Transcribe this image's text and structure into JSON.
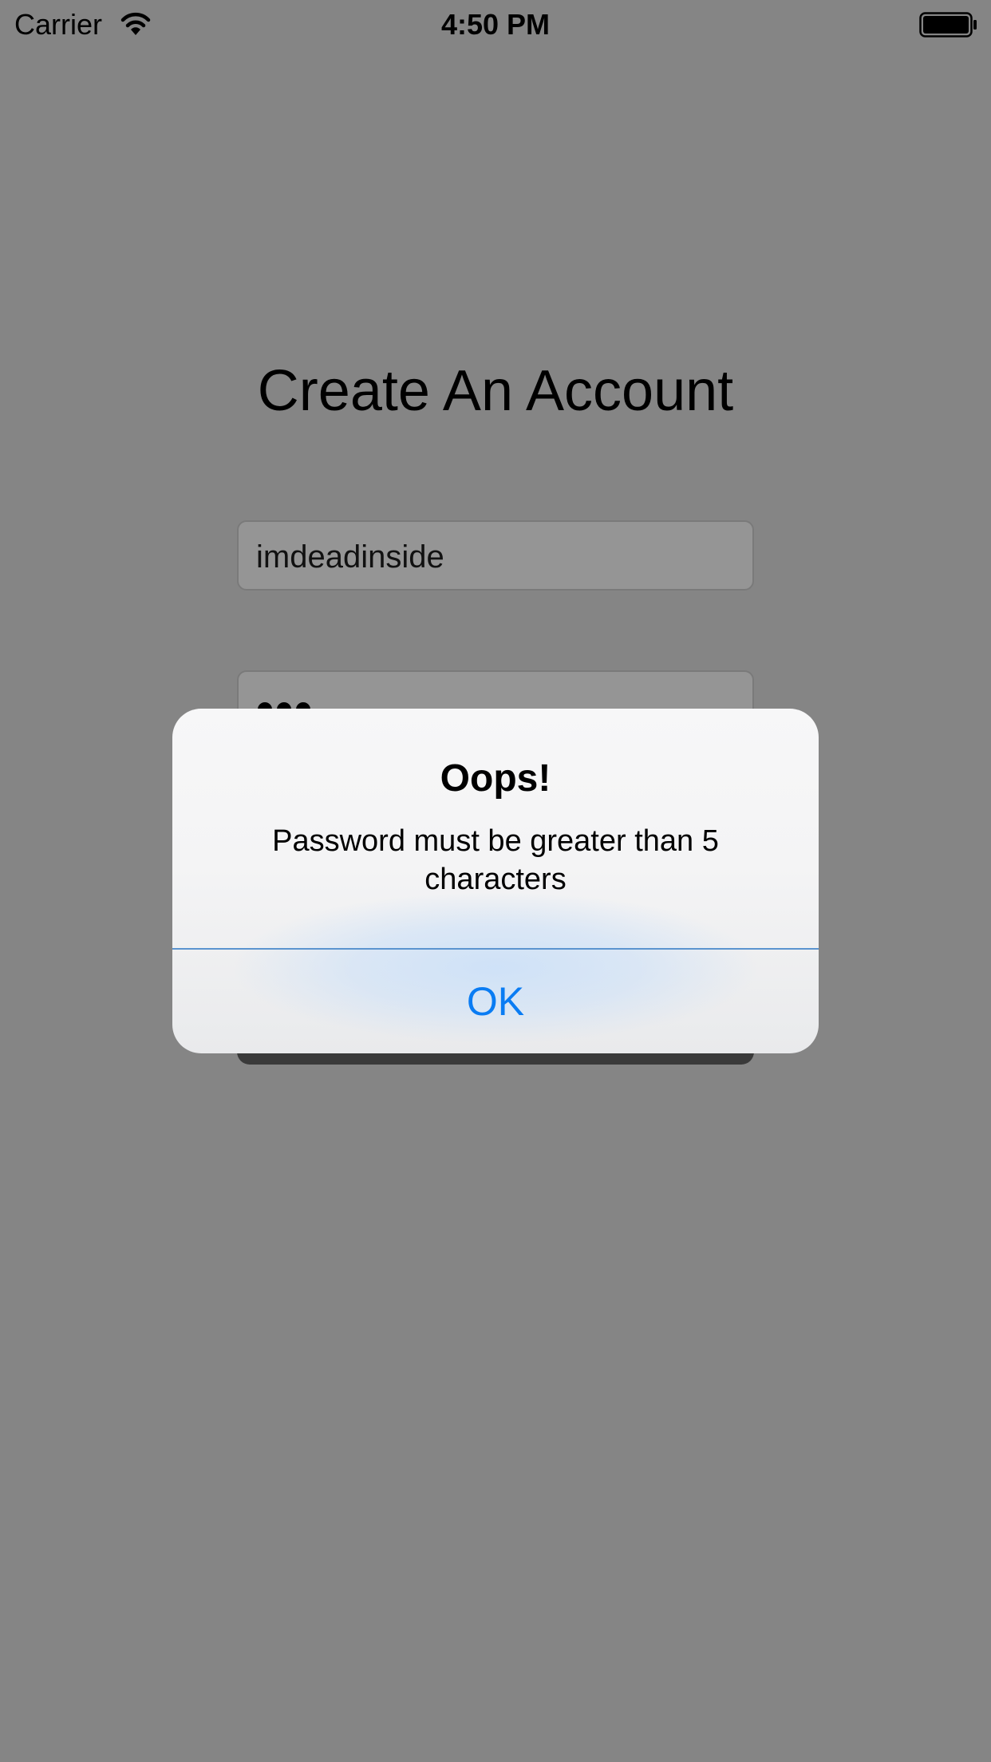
{
  "status_bar": {
    "carrier": "Carrier",
    "time": "4:50 PM",
    "wifi_icon": "wifi-icon",
    "battery_icon": "battery-icon",
    "battery_level": 1.0
  },
  "screen": {
    "title": "Create An Account",
    "username_value": "imdeadinside",
    "password_dot_count": 3
  },
  "alert": {
    "title": "Oops!",
    "message": "Password must be greater than 5 characters",
    "ok_label": "OK"
  },
  "colors": {
    "background": "#858585",
    "accent": "#0a7cf3",
    "field_background": "#959595",
    "button_background": "#3a3a3a"
  }
}
